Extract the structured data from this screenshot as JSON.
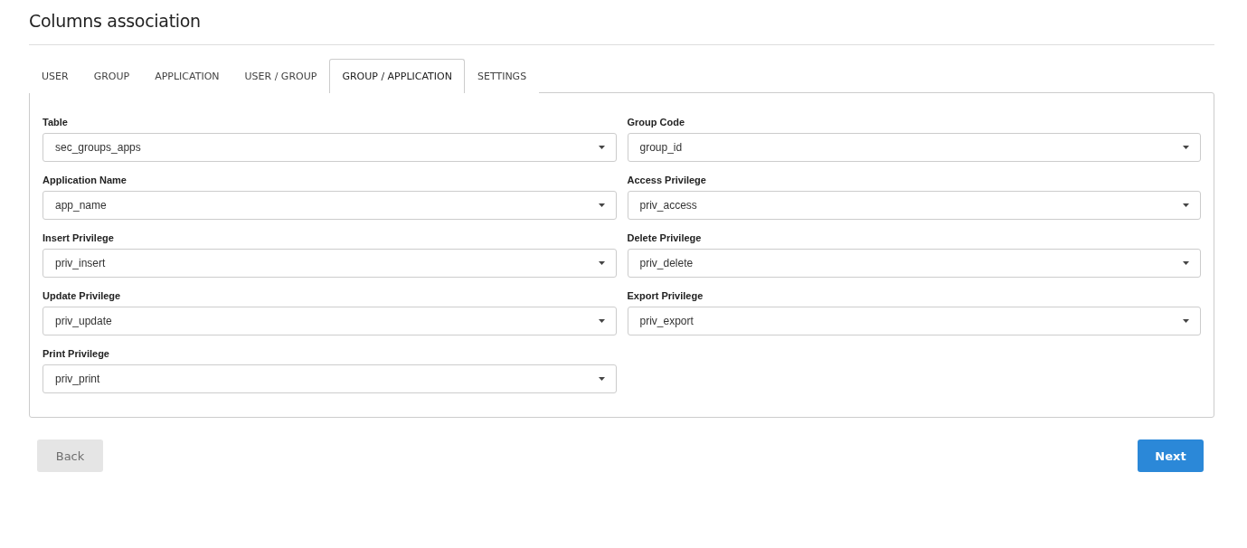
{
  "title": "Columns association",
  "tabs": [
    {
      "label": "USER",
      "selected": false
    },
    {
      "label": "GROUP",
      "selected": false
    },
    {
      "label": "APPLICATION",
      "selected": false
    },
    {
      "label": "USER / GROUP",
      "selected": false
    },
    {
      "label": "GROUP / APPLICATION",
      "selected": true
    },
    {
      "label": "SETTINGS",
      "selected": false
    }
  ],
  "fields": [
    {
      "label": "Table",
      "value": "sec_groups_apps"
    },
    {
      "label": "Group Code",
      "value": "group_id"
    },
    {
      "label": "Application Name",
      "value": "app_name"
    },
    {
      "label": "Access Privilege",
      "value": "priv_access"
    },
    {
      "label": "Insert Privilege",
      "value": "priv_insert"
    },
    {
      "label": "Delete Privilege",
      "value": "priv_delete"
    },
    {
      "label": "Update Privilege",
      "value": "priv_update"
    },
    {
      "label": "Export Privilege",
      "value": "priv_export"
    },
    {
      "label": "Print Privilege",
      "value": "priv_print"
    }
  ],
  "buttons": [
    {
      "label": "Back",
      "kind": "secondary",
      "disabled": true
    },
    {
      "label": "Next",
      "kind": "primary",
      "disabled": false
    }
  ]
}
